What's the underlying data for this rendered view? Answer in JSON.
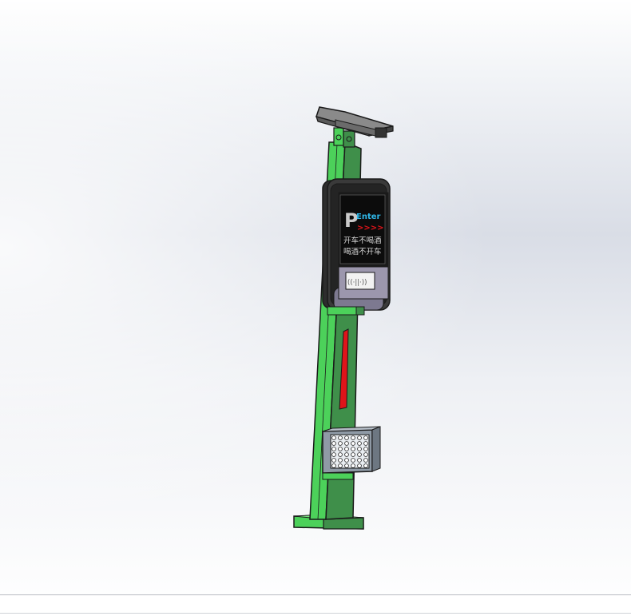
{
  "display": {
    "logo_letter": "P",
    "enter_label": "Enter",
    "arrows": ">>>>",
    "line1": "开车不喝酒",
    "line2": "喝酒不开车",
    "card_reader_label": "((·||·))"
  },
  "colors": {
    "pole_green": "#4cd15a",
    "pole_dark": "#3f8f4a",
    "housing": "#2d2d2d",
    "screen": "#1a1a1a",
    "lower_panel": "#9c97ad",
    "red_strip": "#e0141a",
    "light_panel": "#8f9aa6"
  },
  "icons": {
    "camera": "cctv-camera-icon",
    "reader": "rfid-card-reader-icon",
    "light": "led-fill-light-icon"
  }
}
